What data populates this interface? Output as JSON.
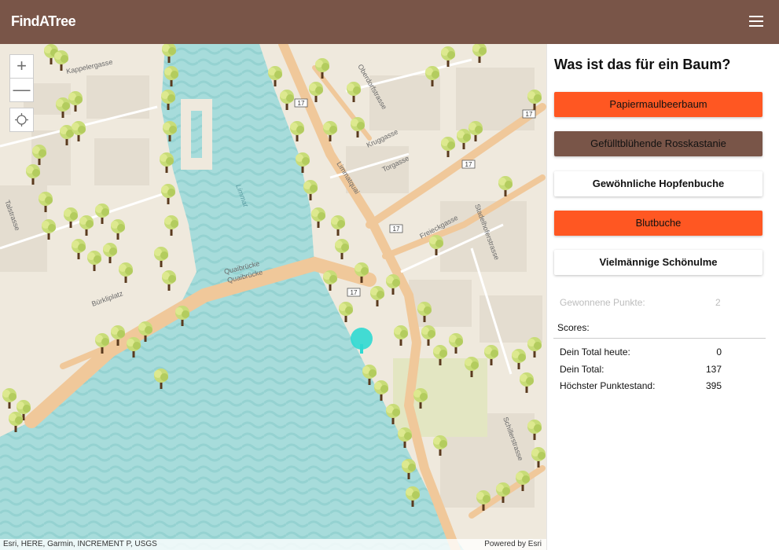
{
  "app": {
    "title": "FindATree"
  },
  "header": {
    "menu_icon": "hamburger-icon"
  },
  "map": {
    "zoom_in": "+",
    "zoom_out": "—",
    "locate_icon": "crosshair-icon",
    "labels": {
      "river": "Limmat",
      "kappelergasse": "Kappelergasse",
      "oberdorfstrasse": "Oberdorfstrasse",
      "kruggasse": "Kruggasse",
      "torgasse": "Torgasse",
      "limmatquai": "Limmatquai",
      "freieckgasse": "Freieckgasse",
      "stadelhoferstrasse": "Stadelhoferstrasse",
      "talstrasse": "Talstrasse",
      "quaibruecke1": "Quaibrücke",
      "quaibruecke2": "Quaibrücke",
      "buerkliplatz": "Bürkliplatz",
      "schillerstrasse": "Schillerstrasse",
      "route_shield": "17"
    },
    "attribution": "Esri, HERE, Garmin, INCREMENT P, USGS",
    "powered_by": "Powered by Esri"
  },
  "panel": {
    "question": "Was ist das für ein Baum?",
    "options": [
      {
        "label": "Papiermaulbeerbaum",
        "color": "#ff5722"
      },
      {
        "label": "Gefülltblühende Rosskastanie",
        "color": "#795548"
      },
      {
        "label": "Gewöhnliche Hopfenbuche",
        "color": "#ffffff"
      },
      {
        "label": "Blutbuche",
        "color": "#ff5722"
      },
      {
        "label": "Vielmännige Schönulme",
        "color": "#ffffff"
      }
    ],
    "points_label": "Gewonnene Punkte:",
    "points_value": "2",
    "scores_label": "Scores:",
    "scores": [
      {
        "label": "Dein Total heute:",
        "value": "0"
      },
      {
        "label": "Dein Total:",
        "value": "137"
      },
      {
        "label": "Höchster Punktestand:",
        "value": "395"
      }
    ]
  },
  "colors": {
    "header": "#795548",
    "accent": "#ff5722",
    "water": "#a6dcdc",
    "land": "#efe9dd",
    "road": "#f0c89a"
  }
}
